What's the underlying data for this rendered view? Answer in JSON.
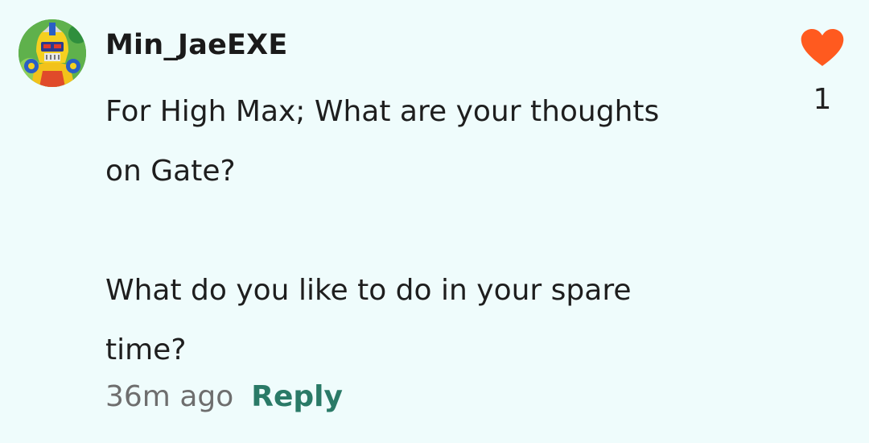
{
  "comment": {
    "username": "Min_JaeEXE",
    "body_lines": [
      "For High Max; What are your thoughts",
      "on Gate?",
      "What do you like to do in your spare",
      "time?"
    ],
    "timestamp": "36m ago",
    "reply_label": "Reply",
    "like_count": "1",
    "like_icon": "heart-icon",
    "avatar_icon": "robot-avatar"
  },
  "colors": {
    "background": "#effcfc",
    "heart": "#ff5a1f",
    "reply": "#2a7a67",
    "timestamp": "#6e6e6e"
  }
}
